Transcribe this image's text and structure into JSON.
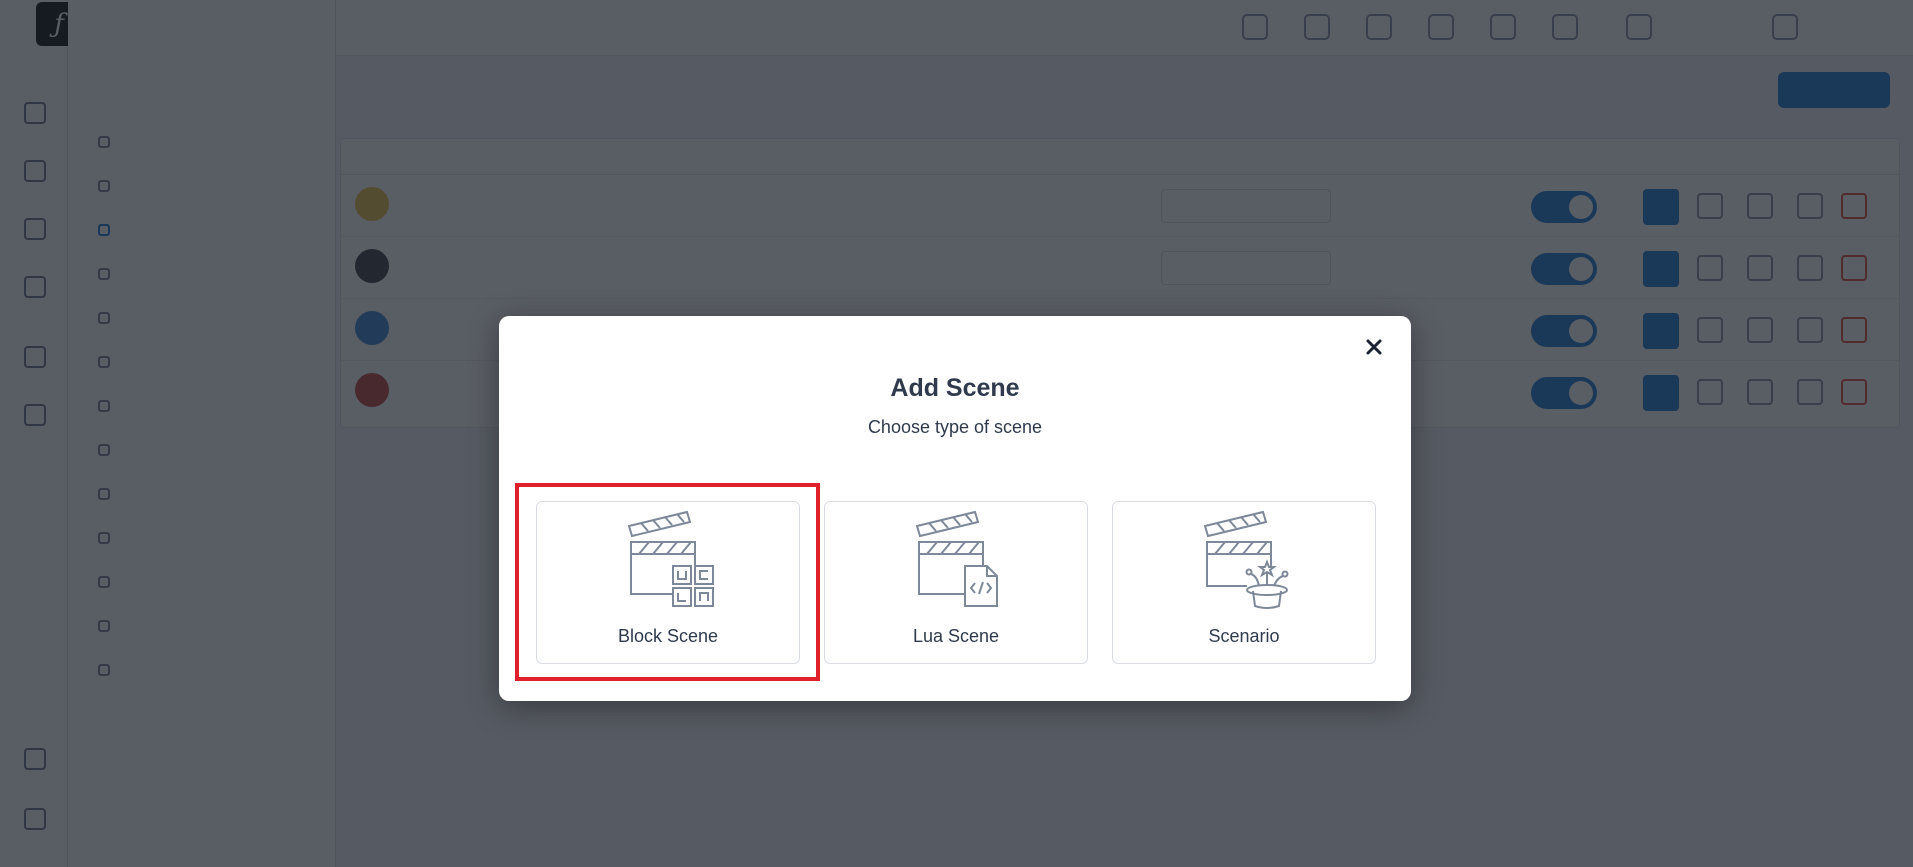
{
  "modal": {
    "title": "Add Scene",
    "subtitle": "Choose type of scene",
    "close_icon": "close-icon",
    "options": [
      {
        "label": "Block Scene",
        "icon": "block-scene-icon",
        "selected": true
      },
      {
        "label": "Lua Scene",
        "icon": "lua-scene-icon",
        "selected": false
      },
      {
        "label": "Scenario",
        "icon": "scenario-icon",
        "selected": false
      }
    ]
  },
  "colors": {
    "accent": "#1f7bd1",
    "highlight": "#e0202a",
    "text": "#2f3a4c",
    "icon_stroke": "#7d8898"
  }
}
